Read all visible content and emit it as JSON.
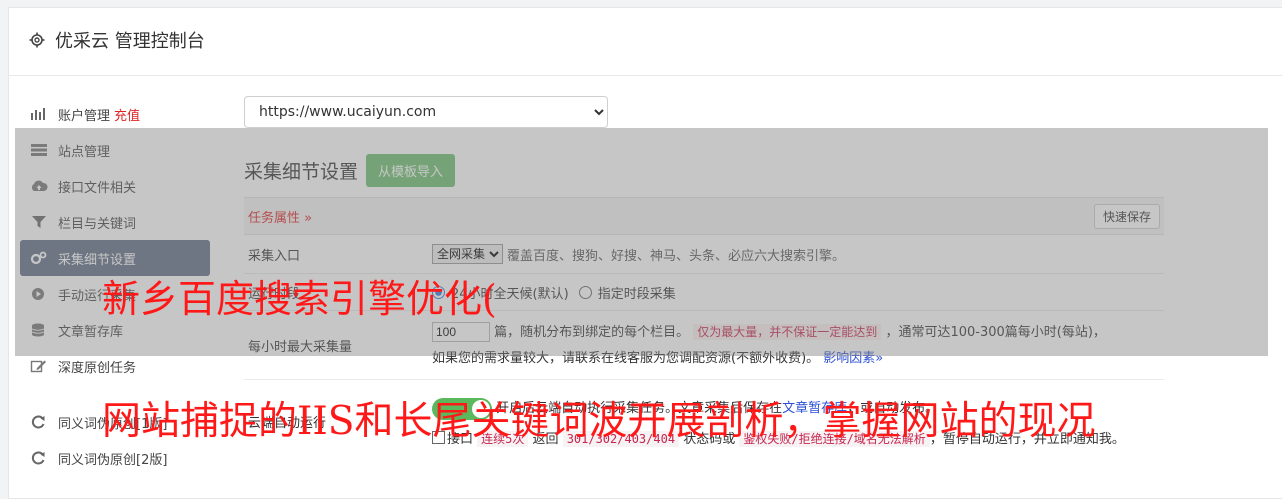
{
  "app": {
    "title": "优采云 管理控制台"
  },
  "sidebar": {
    "items": [
      {
        "label": "账户管理",
        "badge": "充值",
        "icon": "bar-chart-icon"
      },
      {
        "label": "站点管理",
        "icon": "server-icon"
      },
      {
        "label": "接口文件相关",
        "icon": "cloud-upload-icon"
      },
      {
        "label": "栏目与关键词",
        "icon": "filter-icon"
      },
      {
        "label": "采集细节设置",
        "icon": "cogs-icon",
        "active": true
      },
      {
        "label": "手动运行采集",
        "icon": "play-circle-icon"
      },
      {
        "label": "文章暂存库",
        "icon": "database-icon"
      },
      {
        "label": "深度原创任务",
        "icon": "edit-icon"
      },
      {
        "label": "同义词伪原创[1版]",
        "icon": "refresh-icon"
      },
      {
        "label": "同义词伪原创[2版]",
        "icon": "refresh-icon"
      }
    ]
  },
  "main": {
    "site_select": "https://www.ucaiyun.com",
    "section_title": "采集细节设置",
    "import_button": "从模板导入",
    "task_props": "任务属性 »",
    "quick_save": "快速保存",
    "rows": {
      "entry": {
        "label": "采集入口",
        "select": "全网采集",
        "desc": "覆盖百度、搜狗、好搜、神马、头条、必应六大搜索引擎。"
      },
      "time": {
        "label": "运行时段",
        "opt1": "24小时全天候(默认)",
        "opt2": "指定时段采集"
      },
      "max": {
        "label": "每小时最大采集量",
        "value": "100",
        "text1": "篇，随机分布到绑定的每个栏目。",
        "warn": "仅为最大量，并不保证一定能达到",
        "text2": "，通常可达100-300篇每小时(每站)，",
        "text3": "如果您的需求量较大，请联系在线客服为您调配资源(不额外收费)。",
        "link": "影响因素»"
      },
      "cloud": {
        "label": "云端自动运行",
        "desc_a": "开启后云端自动执行采集任务。文章采集后保存在",
        "desc_link": "文章暂存库",
        "desc_b": "，或自动发布。",
        "cb_label": "接口",
        "code1": "连续5次",
        "t1": "返回",
        "code2": "301/302/403/404",
        "t2": "状态码或",
        "code3": "鉴权失败/拒绝连接/域名无法解析",
        "t3": "，暂停自动运行，并立即通知我。"
      }
    }
  },
  "overlay": {
    "line1": "新乡百度搜索引擎优化(",
    "line2": "网站捕捉的IIS和长尾关键词波开展剖析，掌握网站的现况"
  }
}
